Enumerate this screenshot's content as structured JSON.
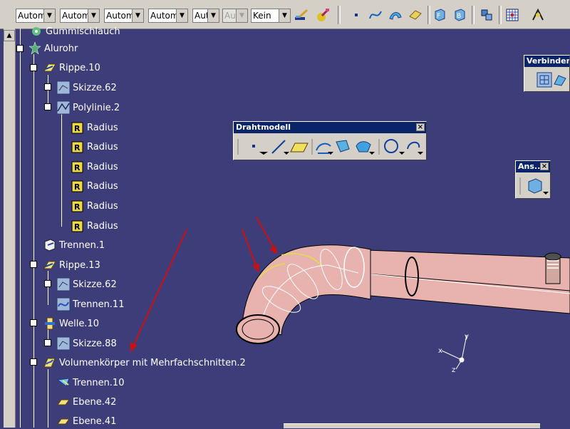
{
  "toolbar": {
    "dropdowns": [
      {
        "value": "Automa",
        "disabled": false
      },
      {
        "value": "Automa",
        "disabled": false
      },
      {
        "value": "Automa",
        "disabled": false
      },
      {
        "value": "Automa",
        "disabled": false
      },
      {
        "value": "Aut",
        "disabled": false
      },
      {
        "value": "Aut",
        "disabled": true
      },
      {
        "value": "Kein",
        "disabled": false
      }
    ],
    "icons": [
      "paintbrush-icon",
      "layer-icon",
      "point-icon",
      "spline-icon",
      "sweep-icon",
      "fill-icon",
      "view-front-icon",
      "view-back-icon",
      "assembly-icon",
      "grid-icon",
      "snap-icon"
    ]
  },
  "tree": {
    "nodes": [
      {
        "label": "Gummischlauch",
        "icon": "assembly-icon"
      },
      {
        "label": "Alurohr",
        "icon": "part-icon"
      },
      {
        "label": "Rippe.10",
        "icon": "rib-icon"
      },
      {
        "label": "Skizze.62",
        "icon": "sketch-icon"
      },
      {
        "label": "Polylinie.2",
        "icon": "polyline-icon"
      },
      {
        "label": "Radius",
        "icon": "radius-icon"
      },
      {
        "label": "Radius",
        "icon": "radius-icon"
      },
      {
        "label": "Radius",
        "icon": "radius-icon"
      },
      {
        "label": "Radius",
        "icon": "radius-icon"
      },
      {
        "label": "Radius",
        "icon": "radius-icon"
      },
      {
        "label": "Radius",
        "icon": "radius-icon"
      },
      {
        "label": "Trennen.1",
        "icon": "split-icon"
      },
      {
        "label": "Rippe.13",
        "icon": "rib-icon"
      },
      {
        "label": "Skizze.62",
        "icon": "sketch-icon"
      },
      {
        "label": "Trennen.11",
        "icon": "split-icon"
      },
      {
        "label": "Welle.10",
        "icon": "shaft-icon"
      },
      {
        "label": "Skizze.88",
        "icon": "sketch-icon"
      },
      {
        "label": "Volumenkörper mit Mehrfachschnitten.2",
        "icon": "multisection-solid-icon"
      },
      {
        "label": "Trennen.10",
        "icon": "split-icon"
      },
      {
        "label": "Ebene.42",
        "icon": "plane-icon"
      },
      {
        "label": "Ebene.41",
        "icon": "plane-icon"
      }
    ]
  },
  "floating": {
    "verbinden_title": "Verbinden-",
    "drahtmodell_title": "Drahtmodell",
    "ansicht_title": "Ans...",
    "close_glyph": "×"
  },
  "colors": {
    "background": "#3d3d7a",
    "pipe": "#e8b3ae",
    "annotation_arrow": "#cc1010"
  }
}
